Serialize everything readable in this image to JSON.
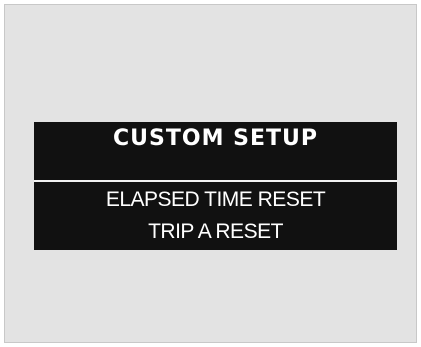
{
  "display": {
    "title": "CUSTOM SETUP",
    "items": [
      {
        "label": "ELAPSED TIME RESET"
      },
      {
        "label": "TRIP A RESET"
      }
    ]
  }
}
